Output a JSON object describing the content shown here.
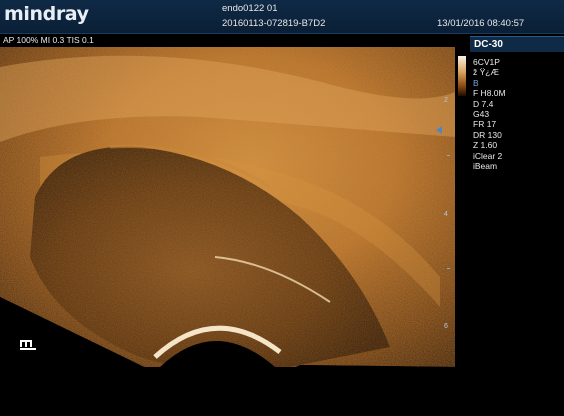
{
  "header": {
    "brand": "mindray",
    "patient": "endo0122 01",
    "exam_id": "20160113-072819-B7D2",
    "datetime": "13/01/2016 08:40:57"
  },
  "acoustic": {
    "text": "AP 100%  MI 0.3 TIS 0.1"
  },
  "device": {
    "probe_tab": "DC-30",
    "probe_model": "6CV1P",
    "preset": "ž Ÿ¿Æ",
    "mode": "B",
    "frequency": "F H8.0M",
    "depth": "D 7.4",
    "gain": "G43",
    "frame_rate": "FR 17",
    "dynamic_range": "DR 130",
    "zoom": "Z 1.60",
    "iclear": "iClear 2",
    "ibeam": "iBeam"
  },
  "depth_scale": {
    "labels": [
      "2",
      "4",
      "6"
    ]
  },
  "colors": {
    "header_bg": "#0f2a46",
    "image_tint": "#c47a2a",
    "mode_text": "#7ea3d6"
  }
}
